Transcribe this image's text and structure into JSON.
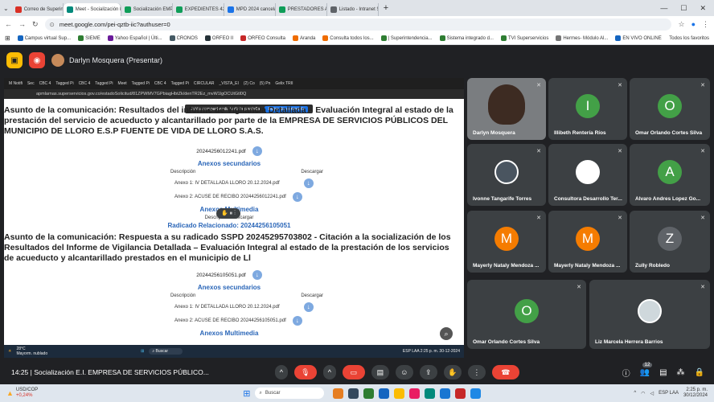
{
  "browser": {
    "tabs": [
      {
        "label": "Correo de Superintendencia de",
        "color": "#d93025",
        "active": false
      },
      {
        "label": "Meet - Socialización E.I. EM",
        "color": "#00897b",
        "active": true
      },
      {
        "label": "Socialización EMPRESA DE SER",
        "color": "#0f9d58",
        "active": false
      },
      {
        "label": "EXPEDIENTES 420 (13).xlsx - Ho",
        "color": "#0f9d58",
        "active": false
      },
      {
        "label": "MPD 2024 cancelación de ofic",
        "color": "#1a73e8",
        "active": false
      },
      {
        "label": "PRESTADORES ACU -NO TRATA",
        "color": "#0f9d58",
        "active": false
      },
      {
        "label": "Listado - Intranet SGDEA Super",
        "color": "#5f6368",
        "active": false
      }
    ],
    "url": "meet.google.com/pei-qztb-iic?authuser=0",
    "bookmarks": [
      "Campus virtual Sup...",
      "SIEME",
      "Yahoo Español | Últi...",
      "CRONOS",
      "ORFEO II",
      "ORFEO Consulta",
      "Aranda",
      "Consulta todos los...",
      "| Superintendencia...",
      "Sistema integrado d...",
      "TVI Superservicios",
      "Hermes- Módulo Al...",
      "EN VIVO ONLINE"
    ],
    "bookmarks_all": "Todos los favoritos"
  },
  "meet": {
    "presenter": "Darlyn Mosquera (Presentar)",
    "inner_tabs": [
      "M Notifi",
      "Sec",
      "CBC 4",
      "Tagged Pi",
      "CBC 4",
      "Tagged Pi",
      "Meet",
      "Tagged Pi",
      "CBC 4",
      "Tagged Pi",
      "CIRCULAR",
      "_VISTA_EI",
      "(2) Co",
      "(5) Pn",
      "Gelix TRII"
    ],
    "inner_url": "apmlarnas.superservicios.gov.co/estadoSolicitud/81ZPWMV7GPbiagHbtZk/denTR2Ez_mvW1lgOCUtGtl0Q",
    "share_banner": "Estás compartiendo toda la pantalla",
    "share_stop": "Dejar de compartir",
    "doc": {
      "heading1": "Asunto de la comunicación: Resultados del informe de Vigilancia Detallada – Evaluación Integral al estado de la prestación del servicio de acueducto y alcantarillado por parte de la EMPRESA DE SERVICIOS PÚBLICOS DEL MUNICIPIO DE LLORO E.S.P FUENTE DE VIDA DE LLORO S.A.S.",
      "file1": "20244256012241.pdf",
      "anexos_sec": "Anexos secundarios",
      "col_desc": "Descripción",
      "col_desc2": "Descargar",
      "anexo1a": "Anexo 1: IV DETALLADA LLORO 20.12.2024.pdf",
      "anexo2a": "Anexo 2: ACUSE DE RECIBO 20244256012241.pdf",
      "anexos_mm": "Anexos Multimedia",
      "mm_desc": "Descripción Descargar",
      "radicado": "Radicado Relacionado: 20244256105051",
      "heading2": "Asunto de la comunicación: Respuesta a su radicado SSPD 20245295703802 - Citación a la socialización de los Resultados del Informe de Vigilancia Detallada – Evaluación Integral al estado de la prestación de los servicios de acueducto y alcantarillado prestados en el municipio de Ll",
      "file2": "20244256105051.pdf",
      "anexo1b": "Anexo 1: IV DETALLADA LLORO 20.12.2024.pdf",
      "anexo2b": "Anexo 2: ACUSE DE RECIBO 20244256105051.pdf",
      "anexos_mm2": "Anexos Multimedia"
    },
    "inner_taskbar": {
      "weather": "28°C",
      "weather_desc": "Mayorm. nublado",
      "search": "Buscar",
      "lang": "ESP LAA",
      "time": "2:25 p. m.",
      "date": "30-12-2024"
    },
    "participants": [
      {
        "name": "Darlyn Mosquera",
        "initial": "",
        "color": "#6b6b6b"
      },
      {
        "name": "Illibeth Rentería Ríos",
        "initial": "I",
        "color": "#43a047"
      },
      {
        "name": "Omar Orlando Cortes Silva",
        "initial": "O",
        "color": "#43a047"
      },
      {
        "name": "Ivonne Tangarife Torres",
        "initial": "",
        "color": "#4a5560"
      },
      {
        "name": "Consultora Desarrollo Ter...",
        "initial": "",
        "color": "#ffffff"
      },
      {
        "name": "Alvaro Andres Lopez Go...",
        "initial": "A",
        "color": "#43a047"
      },
      {
        "name": "Mayerly Nataly Mendoza ...",
        "initial": "M",
        "color": "#f57c00"
      },
      {
        "name": "Mayerly Nataly Mendoza ...",
        "initial": "M",
        "color": "#f57c00"
      },
      {
        "name": "Zully Robledo",
        "initial": "Z",
        "color": "#5f6368"
      },
      {
        "name": "Omar Orlando Cortes Silva",
        "initial": "O",
        "color": "#43a047"
      },
      {
        "name": "Liz Marcela Herrera Barrios",
        "initial": "",
        "color": "#cfd8dc"
      }
    ],
    "meeting_info": "14:25  |  Socialización E.I. EMPRESA DE SERVICIOS PÚBLICO...",
    "participant_count": "12"
  },
  "taskbar": {
    "stock_name": "USD/COP",
    "stock_change": "+0,24%",
    "search": "Buscar",
    "lang": "ESP LAA",
    "time": "2:25 p. m.",
    "date": "30/12/2024"
  }
}
